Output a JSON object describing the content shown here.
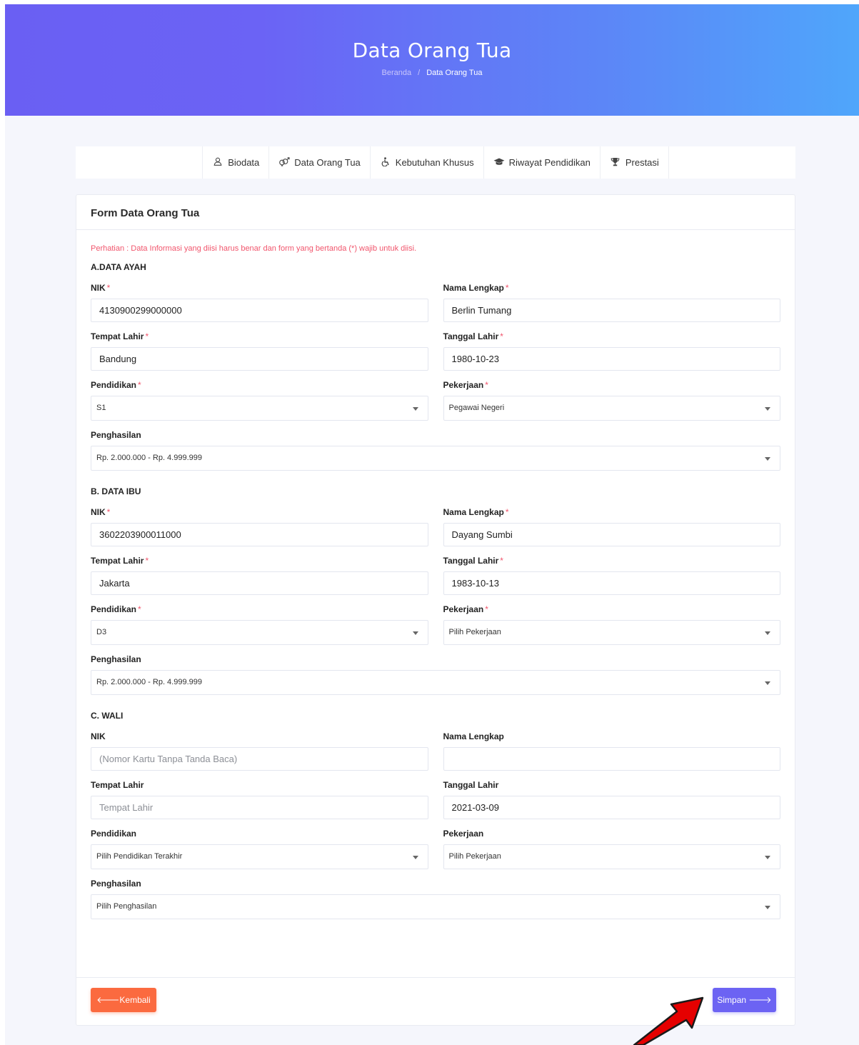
{
  "hero": {
    "title": "Data Orang Tua",
    "breadcrumb_home": "Beranda",
    "breadcrumb_sep": "/",
    "breadcrumb_current": "Data Orang Tua"
  },
  "tabs": [
    {
      "label": "Biodata",
      "icon": "user-icon"
    },
    {
      "label": "Data Orang Tua",
      "icon": "gender-icon"
    },
    {
      "label": "Kebutuhan Khusus",
      "icon": "wheelchair-icon"
    },
    {
      "label": "Riwayat Pendidikan",
      "icon": "graduation-cap-icon"
    },
    {
      "label": "Prestasi",
      "icon": "trophy-icon"
    }
  ],
  "form": {
    "title": "Form Data Orang Tua",
    "notice": "Perhatian : Data Informasi yang diisi harus benar dan form yang bertanda (*) wajib untuk diisi.",
    "required_mark": "*",
    "ayah": {
      "section": "A.DATA AYAH",
      "nik_label": "NIK",
      "nik_value": "4130900299000000",
      "nama_label": "Nama Lengkap",
      "nama_value": "Berlin Tumang",
      "tempat_label": "Tempat Lahir",
      "tempat_value": "Bandung",
      "tanggal_label": "Tanggal Lahir",
      "tanggal_value": "1980-10-23",
      "pendidikan_label": "Pendidikan",
      "pendidikan_value": "S1",
      "pekerjaan_label": "Pekerjaan",
      "pekerjaan_value": "Pegawai Negeri",
      "penghasilan_label": "Penghasilan",
      "penghasilan_value": "Rp. 2.000.000 - Rp. 4.999.999"
    },
    "ibu": {
      "section": "B. DATA IBU",
      "nik_label": "NIK",
      "nik_value": "3602203900011000",
      "nama_label": "Nama Lengkap",
      "nama_value": "Dayang Sumbi",
      "tempat_label": "Tempat Lahir",
      "tempat_value": "Jakarta",
      "tanggal_label": "Tanggal Lahir",
      "tanggal_value": "1983-10-13",
      "pendidikan_label": "Pendidikan",
      "pendidikan_value": "D3",
      "pekerjaan_label": "Pekerjaan",
      "pekerjaan_value": "Pilih Pekerjaan",
      "penghasilan_label": "Penghasilan",
      "penghasilan_value": "Rp. 2.000.000 - Rp. 4.999.999"
    },
    "wali": {
      "section": "C. WALI",
      "nik_label": "NIK",
      "nik_placeholder": "(Nomor Kartu Tanpa Tanda Baca)",
      "nama_label": "Nama Lengkap",
      "nama_value": "",
      "tempat_label": "Tempat Lahir",
      "tempat_placeholder": "Tempat Lahir",
      "tanggal_label": "Tanggal Lahir",
      "tanggal_value": "2021-03-09",
      "pendidikan_label": "Pendidikan",
      "pendidikan_value": "Pilih Pendidikan Terakhir",
      "pekerjaan_label": "Pekerjaan",
      "pekerjaan_value": "Pilih Pekerjaan",
      "penghasilan_label": "Penghasilan",
      "penghasilan_value": "Pilih Penghasilan"
    },
    "back_label": "Kembali",
    "save_label": "Simpan"
  },
  "colors": {
    "accent": "#6c63f3",
    "danger": "#f1556c",
    "back_button": "#fb6a3f",
    "annotation_arrow": "#e50000"
  }
}
